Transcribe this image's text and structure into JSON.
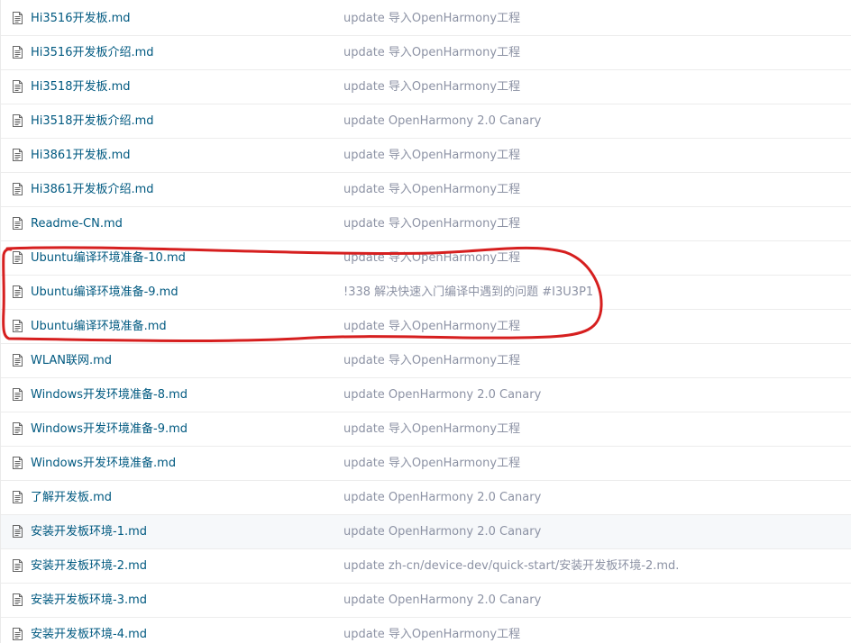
{
  "files": [
    {
      "name": "Hi3516开发板.md",
      "commit": "update 导入OpenHarmony工程"
    },
    {
      "name": "Hi3516开发板介绍.md",
      "commit": "update 导入OpenHarmony工程"
    },
    {
      "name": "Hi3518开发板.md",
      "commit": "update 导入OpenHarmony工程"
    },
    {
      "name": "Hi3518开发板介绍.md",
      "commit": "update OpenHarmony 2.0 Canary"
    },
    {
      "name": "Hi3861开发板.md",
      "commit": "update 导入OpenHarmony工程"
    },
    {
      "name": "Hi3861开发板介绍.md",
      "commit": "update 导入OpenHarmony工程"
    },
    {
      "name": "Readme-CN.md",
      "commit": "update 导入OpenHarmony工程"
    },
    {
      "name": "Ubuntu编译环境准备-10.md",
      "commit": "update 导入OpenHarmony工程"
    },
    {
      "name": "Ubuntu编译环境准备-9.md",
      "commit": "!338 解决快速入门编译中遇到的问题 #I3U3P1"
    },
    {
      "name": "Ubuntu编译环境准备.md",
      "commit": "update 导入OpenHarmony工程"
    },
    {
      "name": "WLAN联网.md",
      "commit": "update 导入OpenHarmony工程"
    },
    {
      "name": "Windows开发环境准备-8.md",
      "commit": "update OpenHarmony 2.0 Canary"
    },
    {
      "name": "Windows开发环境准备-9.md",
      "commit": "update 导入OpenHarmony工程"
    },
    {
      "name": "Windows开发环境准备.md",
      "commit": "update 导入OpenHarmony工程"
    },
    {
      "name": "了解开发板.md",
      "commit": "update OpenHarmony 2.0 Canary"
    },
    {
      "name": "安装开发板环境-1.md",
      "commit": "update OpenHarmony 2.0 Canary"
    },
    {
      "name": "安装开发板环境-2.md",
      "commit": "update zh-cn/device-dev/quick-start/安装开发板环境-2.md."
    },
    {
      "name": "安装开发板环境-3.md",
      "commit": "update OpenHarmony 2.0 Canary"
    },
    {
      "name": "安装开发板环境-4.md",
      "commit": "update 导入OpenHarmony工程"
    }
  ],
  "hovered_row": 15,
  "icons": {
    "file": "file-text-icon"
  },
  "colors": {
    "file_link": "#005980",
    "commit_text": "#8c92a4",
    "annotation": "#d61f1f",
    "hover_bg": "#f6f8fa"
  }
}
